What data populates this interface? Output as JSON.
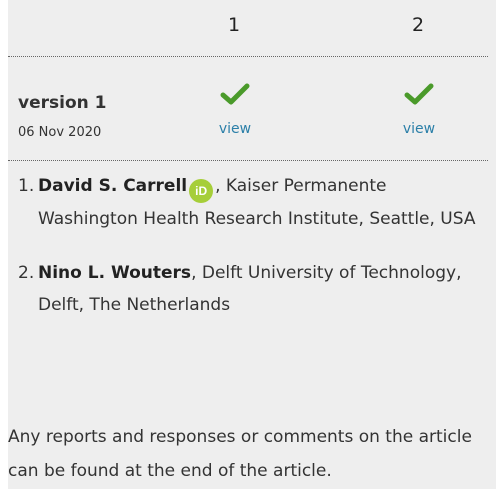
{
  "columns": [
    "1",
    "2"
  ],
  "version": {
    "name": "version 1",
    "date": "06 Nov 2020",
    "reviews": [
      {
        "status_icon": "check-icon",
        "link": "view"
      },
      {
        "status_icon": "check-icon",
        "link": "view"
      }
    ]
  },
  "authors": [
    {
      "num": "1.",
      "name": "David S. Carrell",
      "orcid": "iD",
      "affiliation": ", Kaiser Permanente Washington Health Research Institute, Seattle, USA"
    },
    {
      "num": "2.",
      "name": "Nino L. Wouters",
      "affiliation": ", Delft University of Technology, Delft, The Netherlands"
    }
  ],
  "note": "Any reports and responses or comments on the article can be found at the end of the article.",
  "colors": {
    "check": "#4a9a2a",
    "link": "#2b7fa8",
    "orcid": "#a6ce39"
  }
}
